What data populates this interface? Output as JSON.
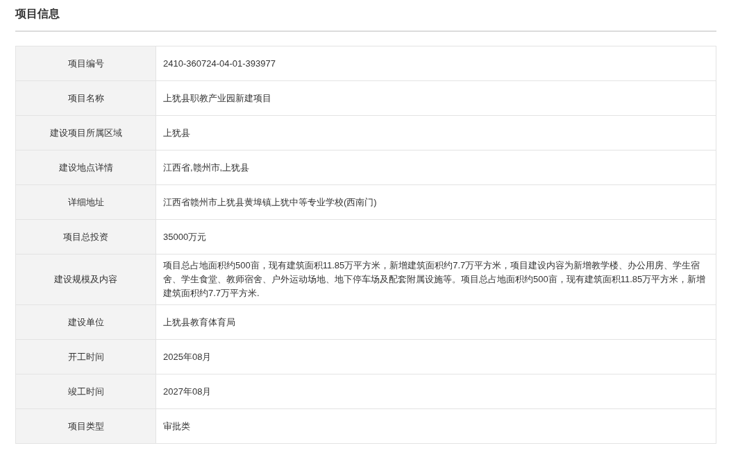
{
  "title": "项目信息",
  "rows": [
    {
      "label": "项目编号",
      "value": "2410-360724-04-01-393977"
    },
    {
      "label": "项目名称",
      "value": "上犹县职教产业园新建项目"
    },
    {
      "label": "建设项目所属区域",
      "value": "上犹县"
    },
    {
      "label": "建设地点详情",
      "value": "江西省,赣州市,上犹县"
    },
    {
      "label": "详细地址",
      "value": "江西省赣州市上犹县黄埠镇上犹中等专业学校(西南门)"
    },
    {
      "label": "项目总投资",
      "value": "35000万元"
    },
    {
      "label": "建设规模及内容",
      "value": "项目总占地面积约500亩，现有建筑面积11.85万平方米，新增建筑面积约7.7万平方米，项目建设内容为新增教学楼、办公用房、学生宿舍、学生食堂、教师宿舍、户外运动场地、地下停车场及配套附属设施等。项目总占地面积约500亩，现有建筑面积11.85万平方米，新增建筑面积约7.7万平方米."
    },
    {
      "label": "建设单位",
      "value": "上犹县教育体育局"
    },
    {
      "label": "开工时间",
      "value": "2025年08月"
    },
    {
      "label": "竣工时间",
      "value": "2027年08月"
    },
    {
      "label": "项目类型",
      "value": "审批类"
    }
  ]
}
